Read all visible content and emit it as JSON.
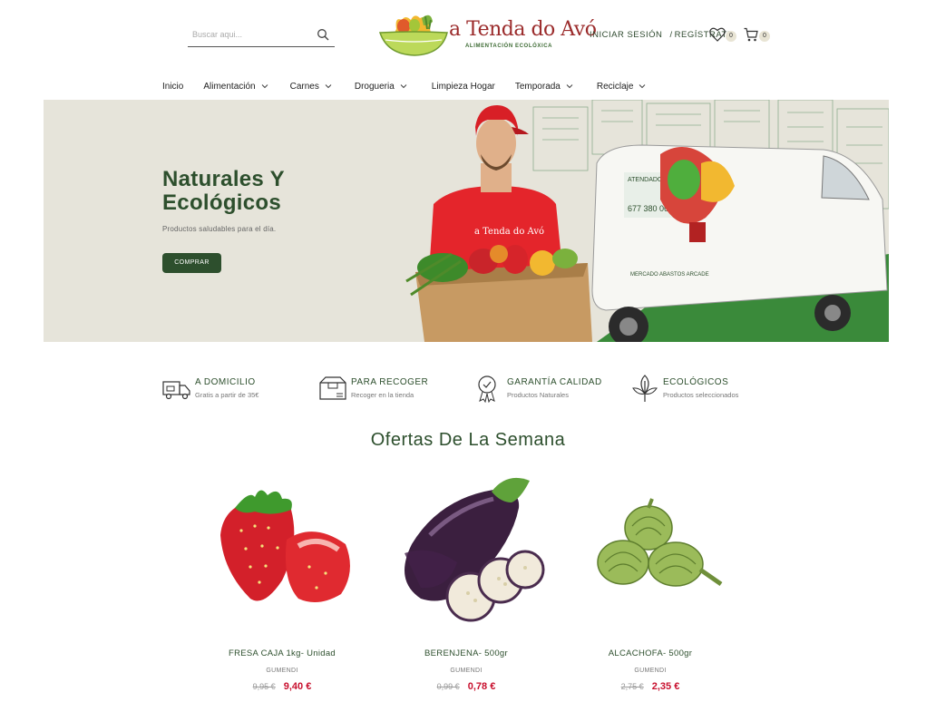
{
  "search": {
    "placeholder": "Buscar aqui..."
  },
  "logo": {
    "name": "a Tenda do Avó",
    "tagline": "ALIMENTACIÓN ECOLÓXICA"
  },
  "account": {
    "login": "INICIAR SESIÓN",
    "separator": "/",
    "register": "REGÍSTRATE",
    "wishlist_count": "0",
    "cart_count": "0"
  },
  "nav": [
    {
      "label": "Inicio",
      "dropdown": false
    },
    {
      "label": "Alimentación",
      "dropdown": true
    },
    {
      "label": "Carnes",
      "dropdown": true
    },
    {
      "label": "Drogueria",
      "dropdown": true
    },
    {
      "label": "Limpieza Hogar",
      "dropdown": false
    },
    {
      "label": "Temporada",
      "dropdown": true
    },
    {
      "label": "Reciclaje",
      "dropdown": true
    }
  ],
  "hero": {
    "title_line1": "Naturales Y",
    "title_line2": "Ecológicos",
    "subtitle": "Productos saludables para el día.",
    "button": "COMPRAR",
    "van_web": "ATENDADOAVO.COM",
    "van_phone": "677 380 060",
    "van_text": "MERCADO ABASTOS ARCADE",
    "shirt_text": "a Tenda do Avó"
  },
  "features": [
    {
      "icon": "delivery-truck-icon",
      "title": "A DOMICILIO",
      "desc": "Gratis a partir de 35€"
    },
    {
      "icon": "pickup-box-icon",
      "title": "PARA RECOGER",
      "desc": "Recoger en la tienda"
    },
    {
      "icon": "quality-badge-icon",
      "title": "GARANTÍA CALIDAD",
      "desc": "Productos Naturales"
    },
    {
      "icon": "leaf-icon",
      "title": "ECOLÓGICOS",
      "desc": "Productos seleccionados"
    }
  ],
  "offers": {
    "title": "Ofertas De La Semana",
    "products": [
      {
        "name": "FRESA CAJA 1kg- Unidad",
        "brand": "GUMENDI",
        "old_price": "9,95 €",
        "price": "9,40 €",
        "image": "strawberry"
      },
      {
        "name": "BERENJENA- 500gr",
        "brand": "GUMENDI",
        "old_price": "0,99 €",
        "price": "0,78 €",
        "image": "eggplant"
      },
      {
        "name": "ALCACHOFA- 500gr",
        "brand": "GUMENDI",
        "old_price": "2,75 €",
        "price": "2,35 €",
        "image": "artichoke"
      }
    ]
  },
  "colors": {
    "brand_green": "#2d4f2d",
    "price_red": "#c8102e",
    "hero_bg": "#e6e4da"
  }
}
